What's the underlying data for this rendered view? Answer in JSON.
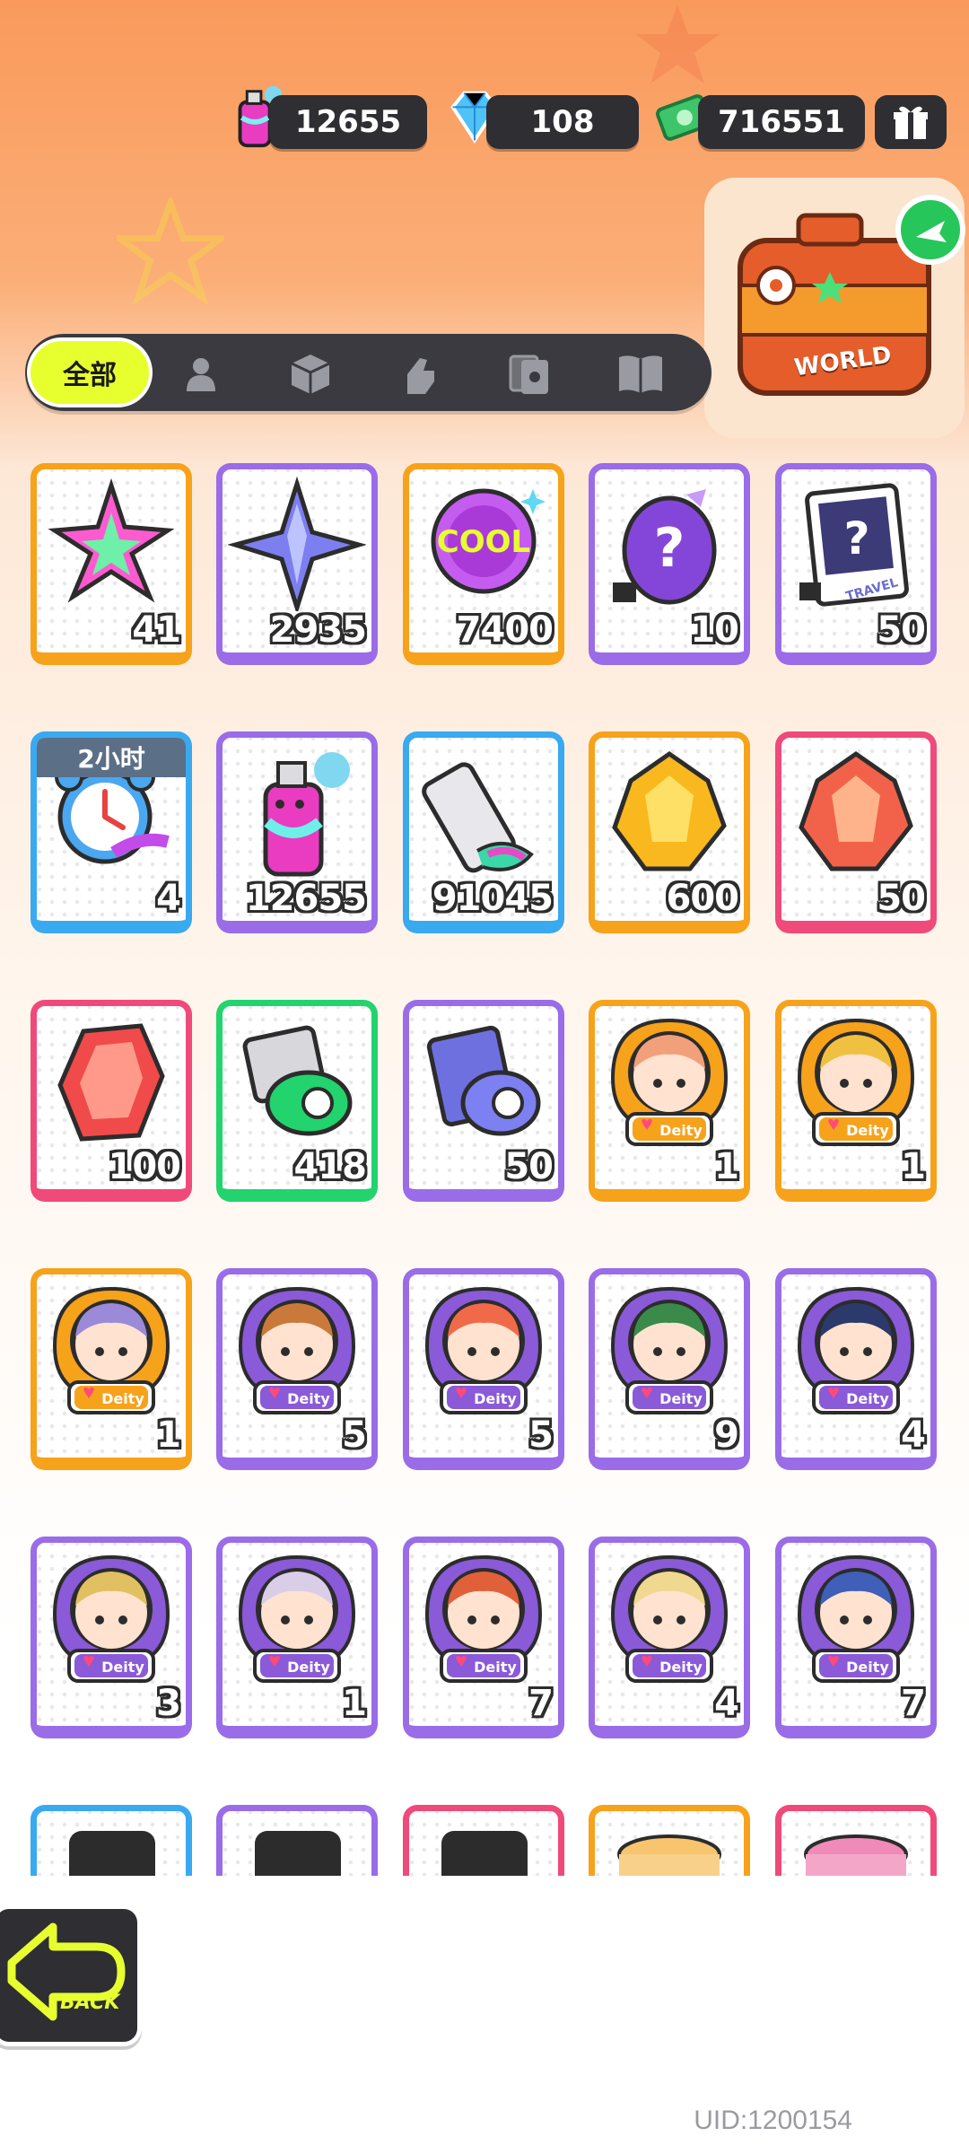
{
  "currencies": {
    "spray": "12655",
    "diamond": "108",
    "cash": "716551"
  },
  "suitcase": {
    "label": "WORLD"
  },
  "tabs": {
    "all": "全部",
    "icons": [
      "person-icon",
      "box-icon",
      "hand-icon",
      "cards-icon",
      "book-icon"
    ]
  },
  "items": [
    {
      "count": "41",
      "rarity": "orange",
      "icon": "rainbow-star-icon"
    },
    {
      "count": "2935",
      "rarity": "purple",
      "icon": "purple-star-icon"
    },
    {
      "count": "7400",
      "rarity": "orange",
      "icon": "cool-badge-icon"
    },
    {
      "count": "10",
      "rarity": "purple",
      "icon": "mystery-egg-icon"
    },
    {
      "count": "50",
      "rarity": "purple",
      "icon": "mystery-card-icon",
      "text": "TRAVEL"
    },
    {
      "count": "4",
      "rarity": "blue",
      "icon": "alarm-clock-icon",
      "timer": "2小时"
    },
    {
      "count": "12655",
      "rarity": "purple",
      "icon": "spray-can-icon"
    },
    {
      "count": "91045",
      "rarity": "blue",
      "icon": "paint-tube-icon"
    },
    {
      "count": "600",
      "rarity": "orange",
      "icon": "gold-crystal-icon"
    },
    {
      "count": "50",
      "rarity": "pink",
      "icon": "red-crystal-icon"
    },
    {
      "count": "100",
      "rarity": "pink",
      "icon": "red-gem-icon"
    },
    {
      "count": "418",
      "rarity": "green",
      "icon": "green-ticket-icon"
    },
    {
      "count": "50",
      "rarity": "purple",
      "icon": "purple-ticket-icon"
    },
    {
      "count": "1",
      "rarity": "orange",
      "icon": "deity-avatar-icon"
    },
    {
      "count": "1",
      "rarity": "orange",
      "icon": "deity-avatar-icon"
    },
    {
      "count": "1",
      "rarity": "orange",
      "icon": "deity-avatar-icon"
    },
    {
      "count": "5",
      "rarity": "purple",
      "icon": "deity-avatar-icon"
    },
    {
      "count": "5",
      "rarity": "purple",
      "icon": "deity-avatar-icon"
    },
    {
      "count": "9",
      "rarity": "purple",
      "icon": "deity-avatar-icon"
    },
    {
      "count": "4",
      "rarity": "purple",
      "icon": "deity-avatar-icon"
    },
    {
      "count": "3",
      "rarity": "purple",
      "icon": "deity-avatar-icon"
    },
    {
      "count": "1",
      "rarity": "purple",
      "icon": "deity-avatar-icon"
    },
    {
      "count": "7",
      "rarity": "purple",
      "icon": "deity-avatar-icon"
    },
    {
      "count": "4",
      "rarity": "purple",
      "icon": "deity-avatar-icon"
    },
    {
      "count": "7",
      "rarity": "purple",
      "icon": "deity-avatar-icon"
    },
    {
      "count": "",
      "rarity": "blue",
      "icon": "phone-card-icon"
    },
    {
      "count": "",
      "rarity": "purple",
      "icon": "phone-card-icon"
    },
    {
      "count": "",
      "rarity": "pink",
      "icon": "phone-card-icon"
    },
    {
      "count": "",
      "rarity": "orange",
      "icon": "tin-can-icon"
    },
    {
      "count": "",
      "rarity": "pink",
      "icon": "pink-can-icon"
    }
  ],
  "deity_label": "Deity",
  "back": {
    "label": "BACK"
  },
  "uid": "UID:1200154"
}
